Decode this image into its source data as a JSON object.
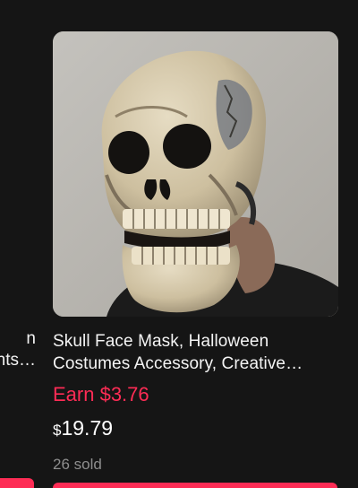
{
  "left_card": {
    "title_line1": "n",
    "title_line2": "nts…"
  },
  "product": {
    "image_alt": "skull-face-mask-photo",
    "title_line1": "Skull Face Mask, Halloween",
    "title_line2": "Costumes Accessory, Creative…",
    "earn": "Earn $3.76",
    "price_currency": "$",
    "price_amount": "19.79",
    "sold": "26 sold"
  },
  "colors": {
    "background": "#151515",
    "accent": "#fe2c55",
    "muted_text": "#8e8e8e"
  }
}
